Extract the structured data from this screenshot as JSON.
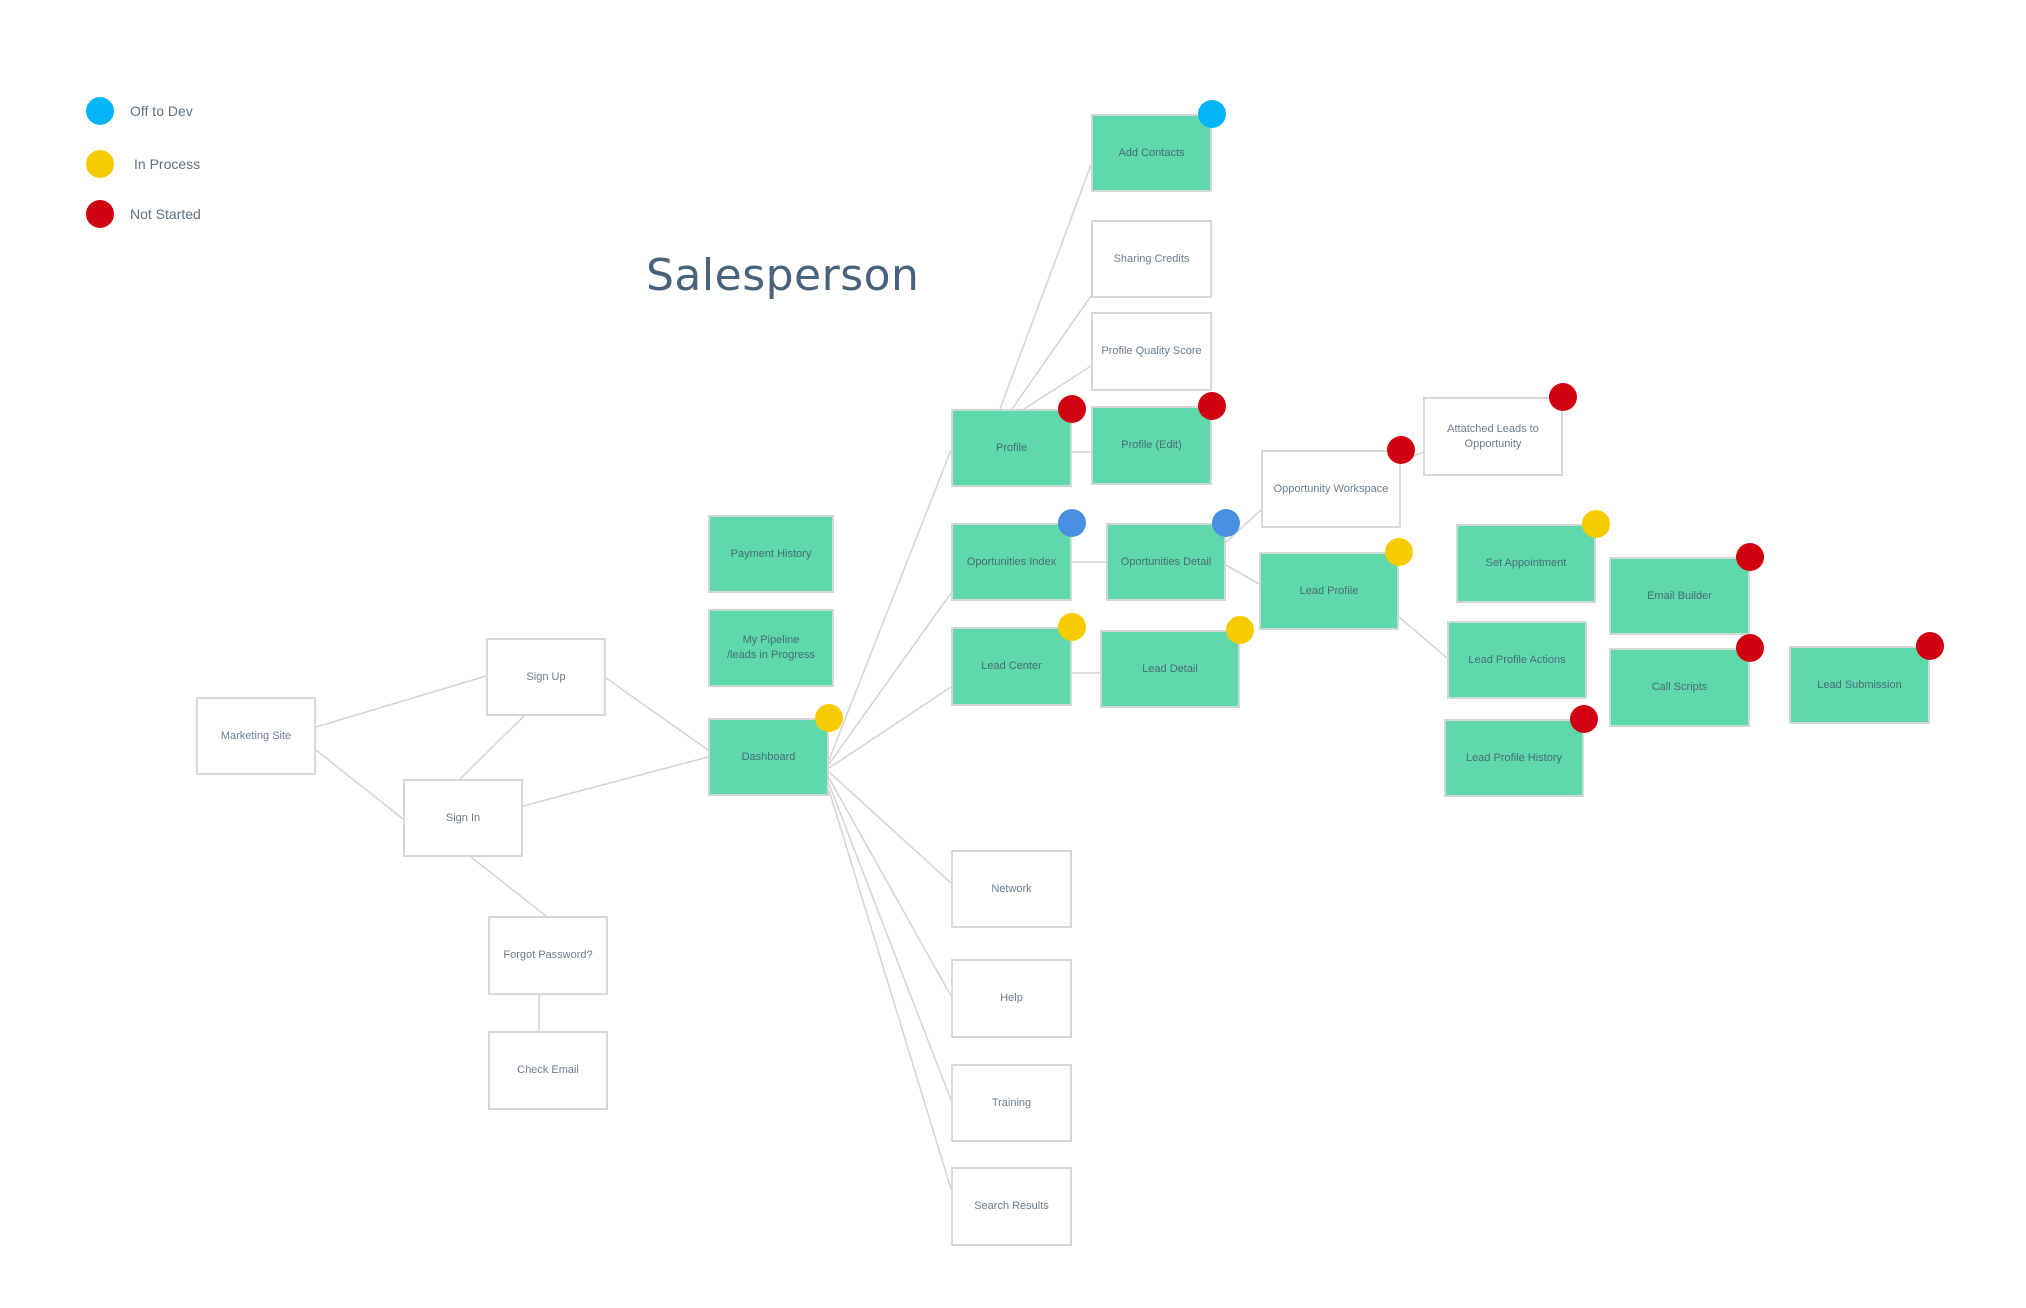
{
  "title": "Salesperson",
  "status_colors": {
    "off_to_dev": "#03b4f7",
    "in_process": "#f6cc00",
    "not_started": "#d10010",
    "in_dev_blue": "#4a90e2"
  },
  "legend": [
    {
      "status": "off_to_dev",
      "label": "Off to Dev",
      "color": "#03b4f7"
    },
    {
      "status": "in_process",
      "label": "In Process",
      "color": "#f6cc00"
    },
    {
      "status": "not_started",
      "label": "Not Started",
      "color": "#d10010"
    }
  ],
  "colors": {
    "built_fill": "#5fd8ac",
    "pending_fill": "#ffffff",
    "edge": "#d3d5d7",
    "title": "#47627a"
  },
  "nodes": [
    {
      "id": "marketing_site",
      "label": "Marketing Site",
      "filled": false,
      "status": null
    },
    {
      "id": "sign_up",
      "label": "Sign Up",
      "filled": false,
      "status": null
    },
    {
      "id": "sign_in",
      "label": "Sign In",
      "filled": false,
      "status": null
    },
    {
      "id": "forgot_password",
      "label": "Forgot Password?",
      "filled": false,
      "status": null
    },
    {
      "id": "check_email",
      "label": "Check Email",
      "filled": false,
      "status": null
    },
    {
      "id": "dashboard",
      "label": "Dashboard",
      "filled": true,
      "status": "in_process"
    },
    {
      "id": "my_pipeline",
      "label": "My Pipeline\n/leads in Progress",
      "filled": true,
      "status": null
    },
    {
      "id": "payment_history",
      "label": "Payment History",
      "filled": true,
      "status": null
    },
    {
      "id": "profile",
      "label": "Profile",
      "filled": true,
      "status": "not_started"
    },
    {
      "id": "opportunities_index",
      "label": "Oportunities Index",
      "filled": true,
      "status": "in_dev_blue"
    },
    {
      "id": "lead_center",
      "label": "Lead Center",
      "filled": true,
      "status": "in_process"
    },
    {
      "id": "network",
      "label": "Network",
      "filled": false,
      "status": null
    },
    {
      "id": "help",
      "label": "Help",
      "filled": false,
      "status": null
    },
    {
      "id": "training",
      "label": "Training",
      "filled": false,
      "status": null
    },
    {
      "id": "search_results",
      "label": "Search Results",
      "filled": false,
      "status": null
    },
    {
      "id": "add_contacts",
      "label": "Add Contacts",
      "filled": true,
      "status": "off_to_dev"
    },
    {
      "id": "sharing_credits",
      "label": "Sharing Credits",
      "filled": false,
      "status": null
    },
    {
      "id": "profile_quality_score",
      "label": "Profile Quality Score",
      "filled": false,
      "status": null
    },
    {
      "id": "profile_edit",
      "label": "Profile (Edit)",
      "filled": true,
      "status": "not_started"
    },
    {
      "id": "opportunities_detail",
      "label": "Oportunities Detail",
      "filled": true,
      "status": "in_dev_blue"
    },
    {
      "id": "lead_detail",
      "label": "Lead Detail",
      "filled": true,
      "status": "in_process"
    },
    {
      "id": "opportunity_workspace",
      "label": "Opportunity Workspace",
      "filled": false,
      "status": "not_started"
    },
    {
      "id": "attached_leads",
      "label": "Attatched Leads to\nOpportunity",
      "filled": false,
      "status": "not_started"
    },
    {
      "id": "lead_profile",
      "label": "Lead Profile",
      "filled": true,
      "status": "in_process"
    },
    {
      "id": "set_appointment",
      "label": "Set Appointment",
      "filled": true,
      "status": "in_process"
    },
    {
      "id": "lead_profile_actions",
      "label": "Lead Profile Actions",
      "filled": true,
      "status": null
    },
    {
      "id": "lead_profile_history",
      "label": "Lead Profile History",
      "filled": true,
      "status": "not_started"
    },
    {
      "id": "email_builder",
      "label": "Email Builder",
      "filled": true,
      "status": "not_started"
    },
    {
      "id": "call_scripts",
      "label": "Call Scripts",
      "filled": true,
      "status": "not_started"
    },
    {
      "id": "lead_submission",
      "label": "Lead Submission",
      "filled": true,
      "status": "not_started"
    }
  ],
  "edges": [
    [
      "marketing_site",
      "sign_up"
    ],
    [
      "marketing_site",
      "sign_in"
    ],
    [
      "sign_up",
      "sign_in"
    ],
    [
      "sign_up",
      "dashboard"
    ],
    [
      "sign_in",
      "dashboard"
    ],
    [
      "sign_in",
      "forgot_password"
    ],
    [
      "forgot_password",
      "check_email"
    ],
    [
      "dashboard",
      "profile"
    ],
    [
      "dashboard",
      "opportunities_index"
    ],
    [
      "dashboard",
      "lead_center"
    ],
    [
      "dashboard",
      "network"
    ],
    [
      "dashboard",
      "help"
    ],
    [
      "dashboard",
      "training"
    ],
    [
      "dashboard",
      "search_results"
    ],
    [
      "profile",
      "add_contacts"
    ],
    [
      "profile",
      "sharing_credits"
    ],
    [
      "profile",
      "profile_quality_score"
    ],
    [
      "profile",
      "profile_edit"
    ],
    [
      "opportunities_index",
      "opportunities_detail"
    ],
    [
      "opportunities_detail",
      "opportunity_workspace"
    ],
    [
      "opportunities_detail",
      "lead_profile"
    ],
    [
      "opportunity_workspace",
      "attached_leads"
    ],
    [
      "lead_center",
      "lead_detail"
    ],
    [
      "lead_profile",
      "lead_profile_actions"
    ]
  ]
}
